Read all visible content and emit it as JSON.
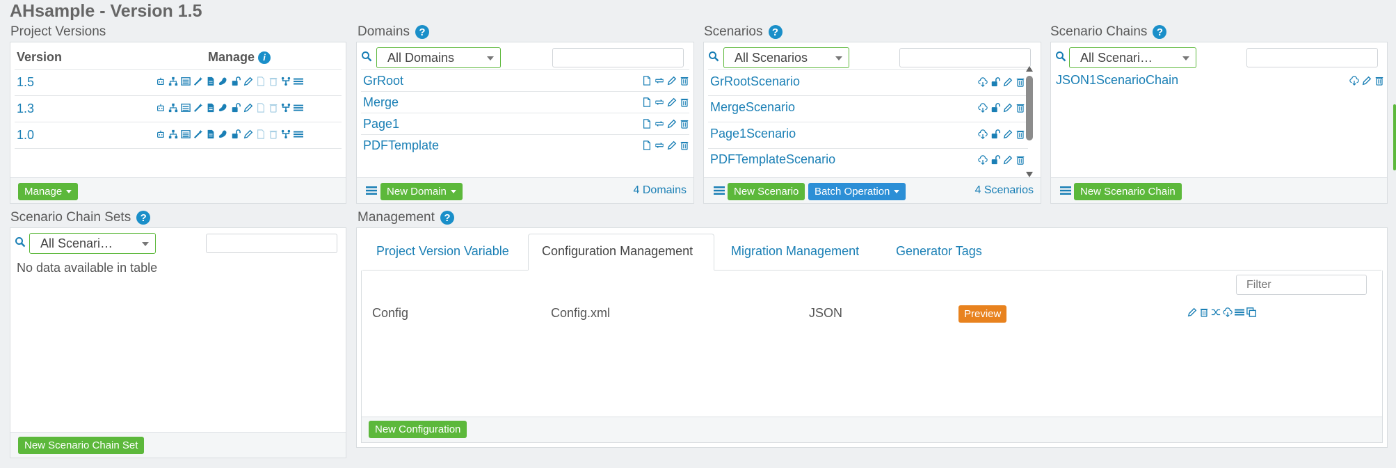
{
  "app_title": "AHsample - Version 1.5",
  "project_versions": {
    "title": "Project Versions",
    "col_version": "Version",
    "col_manage": "Manage",
    "rows": [
      {
        "version": "1.5"
      },
      {
        "version": "1.3"
      },
      {
        "version": "1.0"
      }
    ],
    "manage_button": "Manage"
  },
  "domains": {
    "title": "Domains",
    "filter_selected": "All Domains",
    "items": [
      "GrRoot",
      "Merge",
      "Page1",
      "PDFTemplate"
    ],
    "new_button": "New Domain",
    "count": "4 Domains"
  },
  "scenarios": {
    "title": "Scenarios",
    "filter_selected": "All Scenarios",
    "items": [
      "GrRootScenario",
      "MergeScenario",
      "Page1Scenario",
      "PDFTemplateScenario"
    ],
    "new_button": "New Scenario",
    "batch_button": "Batch Operation",
    "count": "4 Scenarios"
  },
  "scenario_chains": {
    "title": "Scenario Chains",
    "filter_selected": "All Scenari…",
    "items": [
      "JSON1ScenarioChain"
    ],
    "new_button": "New Scenario Chain"
  },
  "scenario_chain_sets": {
    "title": "Scenario Chain Sets",
    "filter_selected": "All Scenari…",
    "empty_text": "No data available in table",
    "new_button": "New Scenario Chain Set"
  },
  "management": {
    "title": "Management",
    "tabs": [
      "Project Version Variable",
      "Configuration Management",
      "Migration Management",
      "Generator Tags"
    ],
    "active_tab": "Configuration Management",
    "filter_placeholder": "Filter",
    "config_row": {
      "name": "Config",
      "file": "Config.xml",
      "format": "JSON",
      "preview": "Preview"
    },
    "new_button": "New Configuration"
  },
  "colors": {
    "accent": "#1a7fb5",
    "green": "#5cb83b",
    "blue": "#2c8fd6",
    "orange": "#e8821e"
  }
}
